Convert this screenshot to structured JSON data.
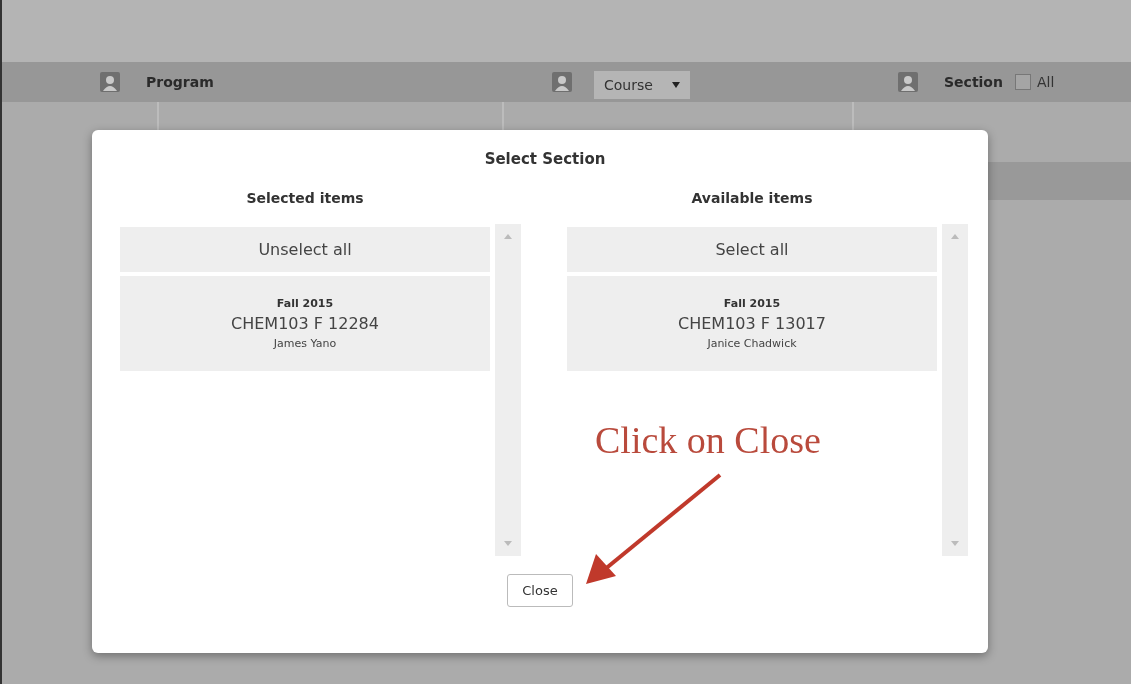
{
  "header": {
    "fields": [
      {
        "kind": "label",
        "label": "Program"
      },
      {
        "kind": "select",
        "value": "Course"
      },
      {
        "kind": "label",
        "label": "Section",
        "checkbox": {
          "label": "All",
          "checked": false
        }
      }
    ]
  },
  "dialog": {
    "title": "Select Section",
    "lists": [
      {
        "heading": "Selected items",
        "action": "Unselect all",
        "items": [
          {
            "term": "Fall 2015",
            "code": "CHEM103 F 12284",
            "instructor": "James Yano"
          }
        ]
      },
      {
        "heading": "Available items",
        "action": "Select all",
        "items": [
          {
            "term": "Fall 2015",
            "code": "CHEM103 F 13017",
            "instructor": "Janice Chadwick"
          }
        ]
      }
    ],
    "close_button": "Close"
  },
  "annotation": {
    "text": "Click on Close"
  }
}
